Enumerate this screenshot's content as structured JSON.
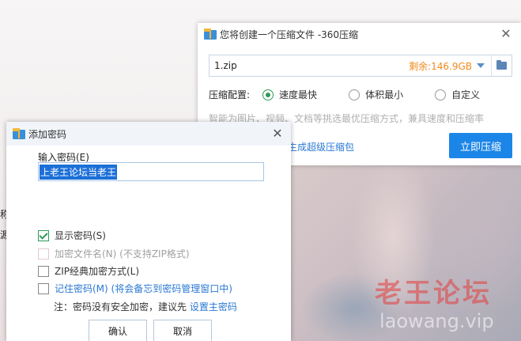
{
  "compress_window": {
    "title": "您将创建一个压缩文件 -360压缩",
    "filename": "1.zip",
    "free_space": "剩余:146.9GB",
    "config_label": "压缩配置:",
    "options": [
      "速度最快",
      "体积最小",
      "自定义"
    ],
    "selected_option": "速度最快",
    "hint": "智能为图片、视频、文档等挑选最优压缩方式，兼具速度和压缩率",
    "link_partial": "生成超级压缩包",
    "compress_button": "立即压缩",
    "icons": [
      "archive-icon",
      "close-icon",
      "dropdown-icon",
      "folder-icon"
    ]
  },
  "password_dialog": {
    "title": "添加密码",
    "input_label": "输入密码(E)",
    "password_value": "上老王论坛当老王",
    "checkboxes": [
      {
        "label": "显示密码(S)",
        "checked": true,
        "enabled": true
      },
      {
        "label": "加密文件名(N) (不支持ZIP格式)",
        "checked": false,
        "enabled": false
      },
      {
        "label": "ZIP经典加密方式(L)",
        "checked": false,
        "enabled": true
      },
      {
        "label": "记住密码(M) (将会备忘到密码管理窗口中)",
        "checked": false,
        "enabled": true
      }
    ],
    "note_prefix": "注：密码没有安全加密，建议先 ",
    "note_link": "设置主密码",
    "ok_button": "确认",
    "cancel_button": "取消"
  },
  "background": {
    "watermark_cn": "老王论坛",
    "watermark_en": "laowang.vip",
    "edge_chars": [
      "称",
      "源"
    ]
  },
  "colors": {
    "accent_blue": "#1c86e8",
    "free_space_orange": "#f08a1c",
    "radio_green": "#2e9a57",
    "selection_blue": "#1b6fd8"
  }
}
